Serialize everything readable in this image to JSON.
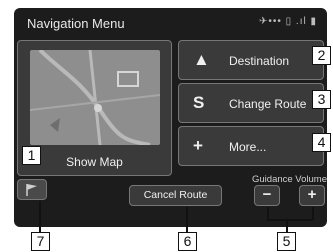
{
  "header": {
    "title": "Navigation Menu",
    "status_text": "✈•••  ▯ .ıl ▮"
  },
  "map_button": {
    "label": "Show Map"
  },
  "menu": [
    {
      "icon": "▲",
      "label": "Destination",
      "icon_name": "arrow-up-icon"
    },
    {
      "icon": "S",
      "label": "Change Route",
      "icon_name": "route-icon"
    },
    {
      "icon": "+",
      "label": "More...",
      "icon_name": "plus-icon"
    }
  ],
  "footer": {
    "cancel_label": "Cancel Route",
    "volume_label": "Guidance Volume",
    "minus": "−",
    "plus": "+"
  },
  "callouts": {
    "c1": "1",
    "c2": "2",
    "c3": "3",
    "c4": "4",
    "c5": "5",
    "c6": "6",
    "c7": "7"
  },
  "colors": {
    "screen_bg": "#1c1c1c",
    "button_bg": "#3a3a3a",
    "map_bg": "#8e8e8e"
  }
}
